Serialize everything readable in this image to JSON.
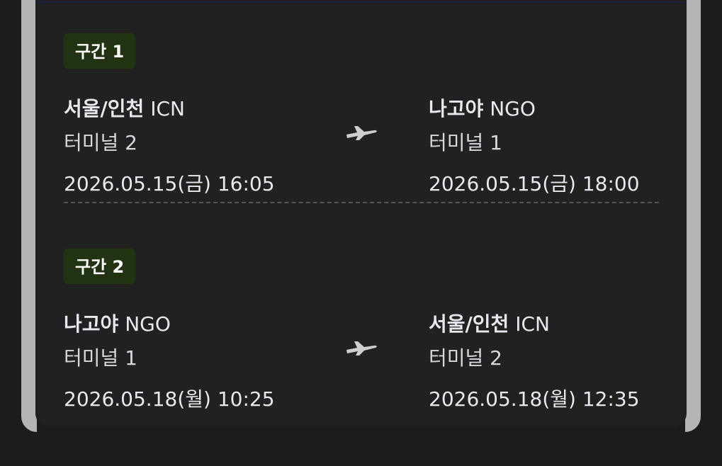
{
  "segments": [
    {
      "badge": "구간 1",
      "departure": {
        "city": "서울/인천",
        "code": "ICN",
        "terminal": "터미널 2",
        "datetime": "2026.05.15(금) 16:05"
      },
      "arrival": {
        "city": "나고야",
        "code": "NGO",
        "terminal": "터미널 1",
        "datetime": "2026.05.15(금) 18:00"
      }
    },
    {
      "badge": "구간 2",
      "departure": {
        "city": "나고야",
        "code": "NGO",
        "terminal": "터미널 1",
        "datetime": "2026.05.18(월) 10:25"
      },
      "arrival": {
        "city": "서울/인천",
        "code": "ICN",
        "terminal": "터미널 2",
        "datetime": "2026.05.18(월) 12:35"
      }
    }
  ],
  "colors": {
    "badge_bg": "#213311",
    "card_bg": "#212121",
    "text": "#e8e8ef"
  },
  "icons": {
    "route": "airplane-icon"
  }
}
